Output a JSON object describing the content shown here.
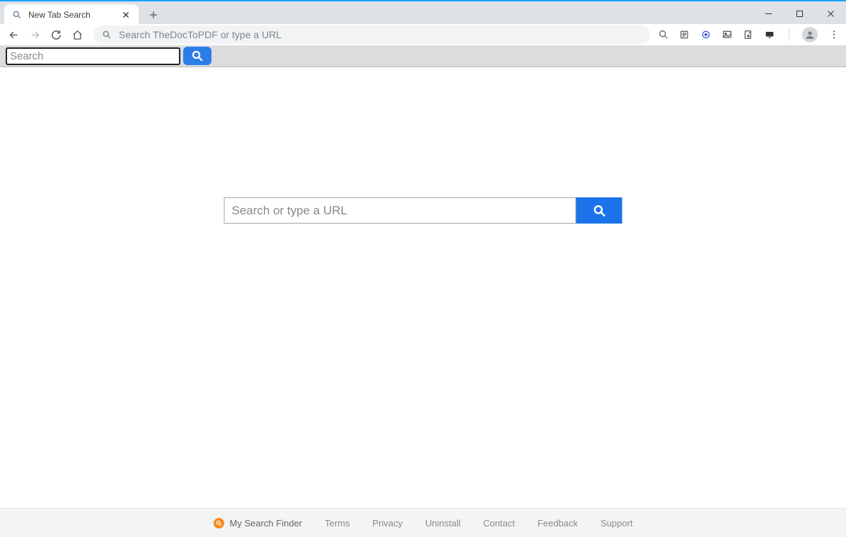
{
  "tab": {
    "title": "New Tab Search"
  },
  "omnibox": {
    "placeholder": "Search TheDocToPDF or type a URL"
  },
  "extToolbar": {
    "searchPlaceholder": "Search"
  },
  "center": {
    "searchPlaceholder": "Search or type a URL"
  },
  "footer": {
    "brand": "My Search Finder",
    "links": [
      "Terms",
      "Privacy",
      "Uninstall",
      "Contact",
      "Feedback",
      "Support"
    ]
  }
}
